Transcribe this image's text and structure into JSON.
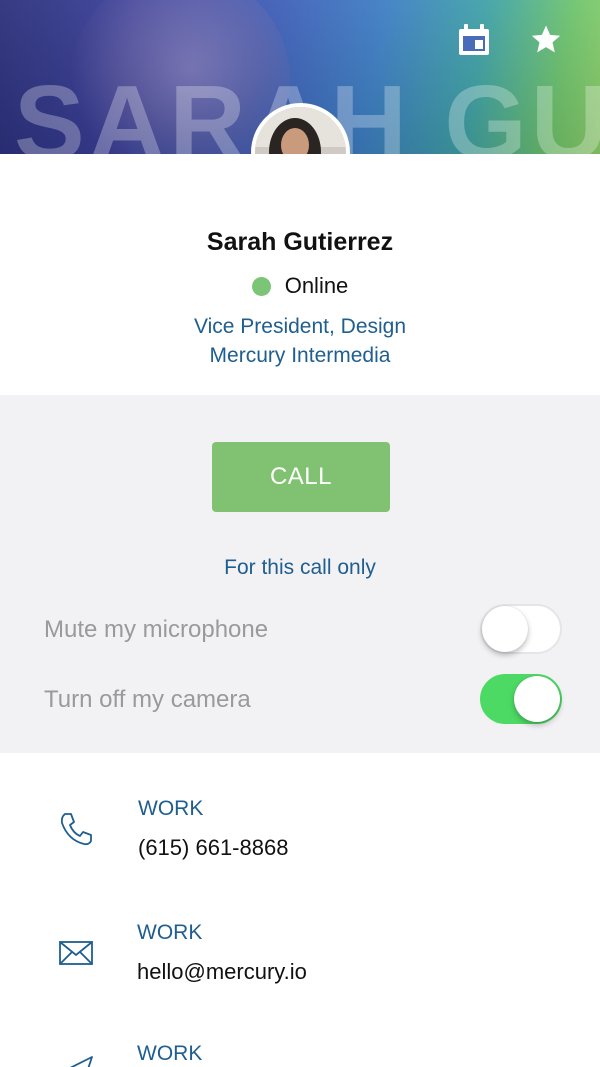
{
  "header": {
    "watermark": "SARAH GUTIERREZ",
    "icons": [
      "calendar-icon",
      "star-icon"
    ]
  },
  "profile": {
    "name": "Sarah Gutierrez",
    "status": "Online",
    "status_color": "#7cc576",
    "job_title": "Vice President, Design",
    "company": "Mercury Intermedia"
  },
  "call_panel": {
    "call_label": "CALL",
    "call_color": "#80c271",
    "section_label": "For this call only",
    "options": [
      {
        "label": "Mute my microphone",
        "enabled": false
      },
      {
        "label": "Turn off my camera",
        "enabled": true
      }
    ],
    "toggle_on_color": "#4cd964"
  },
  "contacts": [
    {
      "icon": "phone-icon",
      "type": "WORK",
      "value": "(615) 661-8868"
    },
    {
      "icon": "mail-icon",
      "type": "WORK",
      "value": "hello@mercury.io"
    },
    {
      "icon": "send-icon",
      "type": "WORK",
      "value": ""
    }
  ],
  "colors": {
    "accent_text": "#1f5e8f",
    "panel_bg": "#f2f2f4"
  }
}
